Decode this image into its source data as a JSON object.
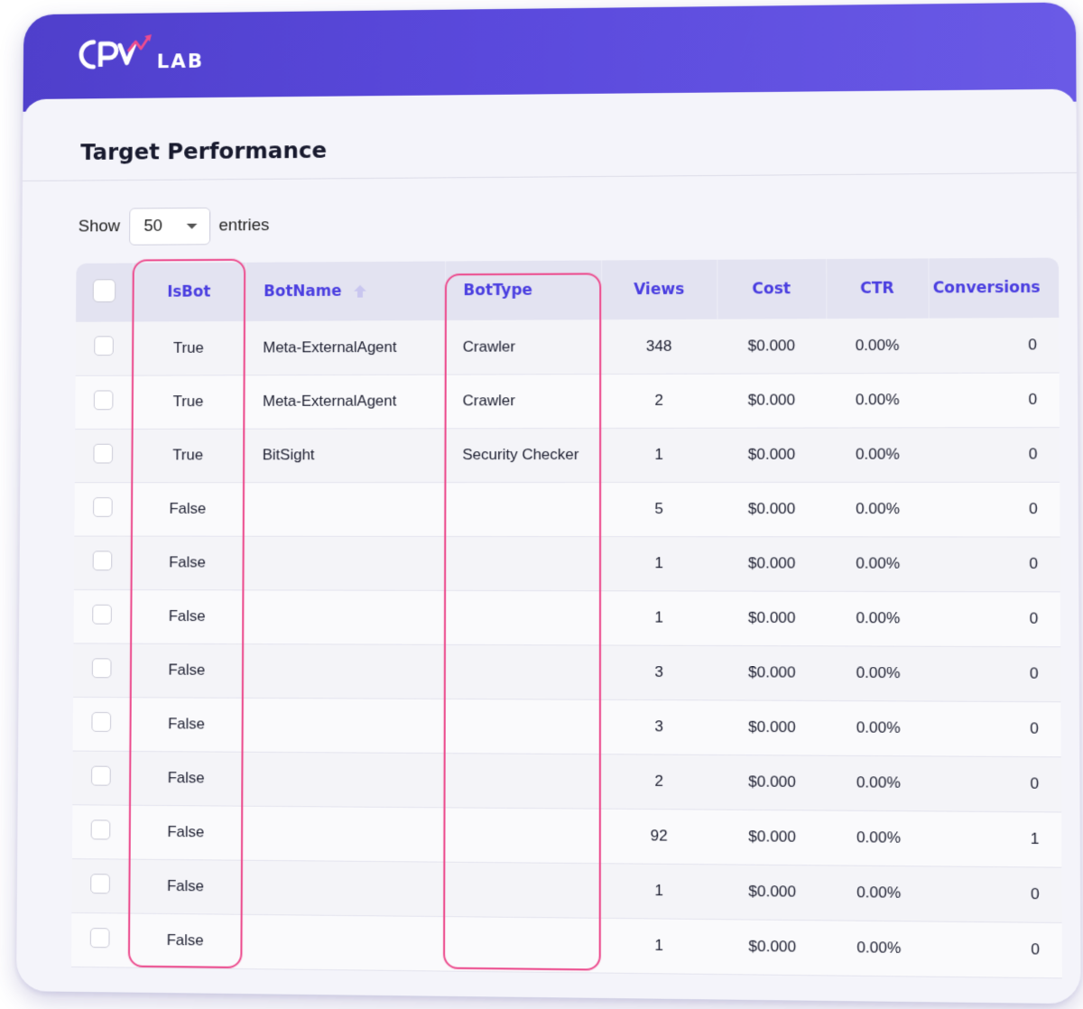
{
  "brand": {
    "logo_letters": "CPV",
    "logo_suffix": "LAB",
    "accent": "#5a49dc",
    "highlight": "#ec4c8e"
  },
  "page": {
    "title": "Target Performance"
  },
  "length_menu": {
    "prefix": "Show",
    "value": "50",
    "suffix": "entries"
  },
  "table": {
    "columns": {
      "isbot": "IsBot",
      "botname": "BotName",
      "bottype": "BotType",
      "views": "Views",
      "cost": "Cost",
      "ctr": "CTR",
      "conversions": "Conversions"
    },
    "sort": {
      "column": "BotName",
      "direction": "ascending",
      "icon": "arrow-up-icon"
    },
    "highlighted_columns": [
      "IsBot",
      "BotType"
    ],
    "rows": [
      {
        "isbot": "True",
        "botname": "Meta-ExternalAgent",
        "bottype": "Crawler",
        "views": "348",
        "cost": "$0.000",
        "ctr": "0.00%",
        "conversions": "0"
      },
      {
        "isbot": "True",
        "botname": "Meta-ExternalAgent",
        "bottype": "Crawler",
        "views": "2",
        "cost": "$0.000",
        "ctr": "0.00%",
        "conversions": "0"
      },
      {
        "isbot": "True",
        "botname": "BitSight",
        "bottype": "Security Checker",
        "views": "1",
        "cost": "$0.000",
        "ctr": "0.00%",
        "conversions": "0"
      },
      {
        "isbot": "False",
        "botname": "",
        "bottype": "",
        "views": "5",
        "cost": "$0.000",
        "ctr": "0.00%",
        "conversions": "0"
      },
      {
        "isbot": "False",
        "botname": "",
        "bottype": "",
        "views": "1",
        "cost": "$0.000",
        "ctr": "0.00%",
        "conversions": "0"
      },
      {
        "isbot": "False",
        "botname": "",
        "bottype": "",
        "views": "1",
        "cost": "$0.000",
        "ctr": "0.00%",
        "conversions": "0"
      },
      {
        "isbot": "False",
        "botname": "",
        "bottype": "",
        "views": "3",
        "cost": "$0.000",
        "ctr": "0.00%",
        "conversions": "0"
      },
      {
        "isbot": "False",
        "botname": "",
        "bottype": "",
        "views": "3",
        "cost": "$0.000",
        "ctr": "0.00%",
        "conversions": "0"
      },
      {
        "isbot": "False",
        "botname": "",
        "bottype": "",
        "views": "2",
        "cost": "$0.000",
        "ctr": "0.00%",
        "conversions": "0"
      },
      {
        "isbot": "False",
        "botname": "",
        "bottype": "",
        "views": "92",
        "cost": "$0.000",
        "ctr": "0.00%",
        "conversions": "1"
      },
      {
        "isbot": "False",
        "botname": "",
        "bottype": "",
        "views": "1",
        "cost": "$0.000",
        "ctr": "0.00%",
        "conversions": "0"
      },
      {
        "isbot": "False",
        "botname": "",
        "bottype": "",
        "views": "1",
        "cost": "$0.000",
        "ctr": "0.00%",
        "conversions": "0"
      }
    ]
  }
}
